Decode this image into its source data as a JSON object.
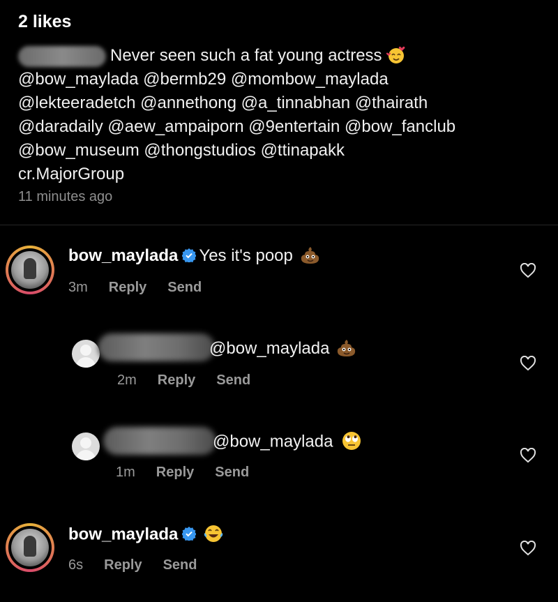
{
  "caption": {
    "likes": "2 likes",
    "lines": [
      "Never seen such a fat young actress",
      "@bow_maylada @bermb29 @mombow_maylada",
      "@lekteeradetch @annethong @a_tinnabhan @thairath",
      "@daradaily @aew_ampaiporn @9entertain @bow_fanclub",
      "@bow_museum @thongstudios @ttinapakk",
      "cr.MajorGroup"
    ],
    "time": "11 minutes ago"
  },
  "comments": [
    {
      "username": "bow_maylada",
      "verified": true,
      "text": "Yes it's poop",
      "emoji": "poop-emoji",
      "time": "3m",
      "reply_label": "Reply",
      "send_label": "Send"
    },
    {
      "username": "",
      "text": "@bow_maylada",
      "emoji": "poop-emoji",
      "time": "2m",
      "reply_label": "Reply",
      "send_label": "Send"
    },
    {
      "username": "",
      "text": "@bow_maylada",
      "emoji": "eye-roll-emoji",
      "time": "1m",
      "reply_label": "Reply",
      "send_label": "Send"
    },
    {
      "username": "bow_maylada",
      "verified": true,
      "text": "",
      "emoji": "laughing-tears-emoji",
      "time": "6s",
      "reply_label": "Reply",
      "send_label": "Send"
    }
  ],
  "colors": {
    "background": "#000000",
    "verified": "#3897f0",
    "meta": "#9a9a9a",
    "text": "#f2f2f2"
  }
}
